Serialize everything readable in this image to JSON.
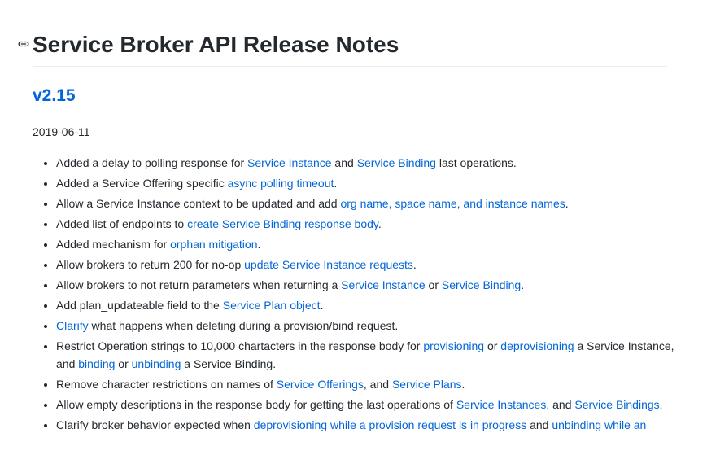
{
  "heading": "Service Broker API Release Notes",
  "version": "v2.15",
  "date": "2019-06-11",
  "items": [
    {
      "t1": "Added a delay to polling response for ",
      "l1": "Service Instance",
      "t2": " and ",
      "l2": "Service Binding",
      "t3": " last operations."
    },
    {
      "t1": "Added a Service Offering specific ",
      "l1": "async polling timeout",
      "t2": "."
    },
    {
      "t1": "Allow a Service Instance context to be updated and add ",
      "l1": "org name, space name, and instance names",
      "t2": "."
    },
    {
      "t1": "Added list of endpoints to ",
      "l1": "create Service Binding response body",
      "t2": "."
    },
    {
      "t1": "Added mechanism for ",
      "l1": "orphan mitigation",
      "t2": "."
    },
    {
      "t1": "Allow brokers to return 200 for no-op ",
      "l1": "update Service Instance requests",
      "t2": "."
    },
    {
      "t1": "Allow brokers to not return parameters when returning a ",
      "l1": "Service Instance",
      "t2": " or ",
      "l2": "Service Binding",
      "t3": "."
    },
    {
      "t1": "Add plan_updateable field to the ",
      "l1": "Service Plan object",
      "t2": "."
    },
    {
      "l1": "Clarify",
      "t2": " what happens when deleting during a provision/bind request."
    },
    {
      "t1": "Restrict Operation strings to 10,000 chartacters in the response body for ",
      "l1": "provisioning",
      "t2": " or ",
      "l2": "deprovisioning",
      "t3": " a Service Instance, and ",
      "l3": "binding",
      "t4": " or ",
      "l4": "unbinding",
      "t5": " a Service Binding."
    },
    {
      "t1": "Remove character restrictions on names of ",
      "l1": "Service Offerings",
      "t2": ", and ",
      "l2": "Service Plans",
      "t3": "."
    },
    {
      "t1": "Allow empty descriptions in the response body for getting the last operations of ",
      "l1": "Service Instances",
      "t2": ", and ",
      "l2": "Service Bindings",
      "t3": "."
    },
    {
      "t1": "Clarify broker behavior expected when ",
      "l1": "deprovisioning while a provision request is in progress",
      "t2": " and ",
      "l2": "unbinding while an"
    }
  ]
}
